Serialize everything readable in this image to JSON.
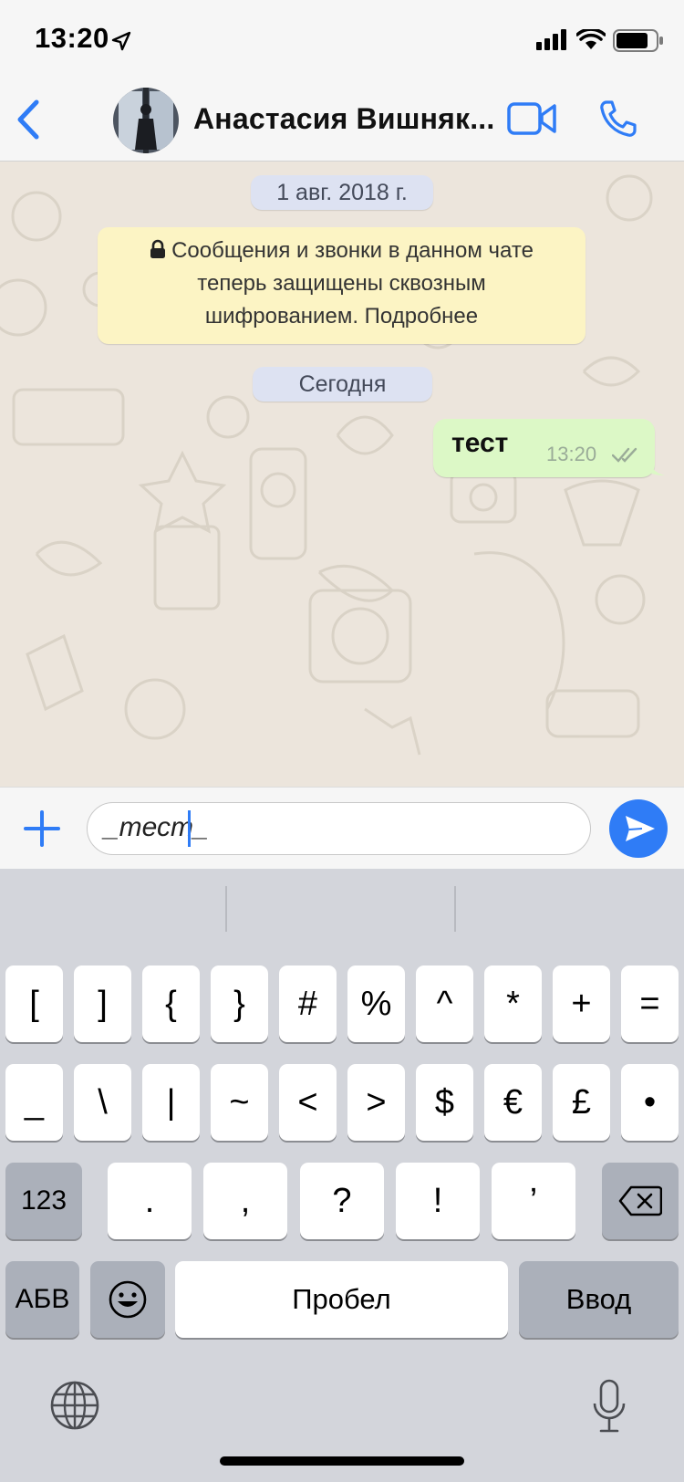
{
  "status_bar": {
    "time": "13:20"
  },
  "header": {
    "contact_name": "Анастасия Вишняк...",
    "accent_color": "#2f7cf6"
  },
  "chat": {
    "date_label": "1 авг. 2018 г.",
    "encryption_notice": {
      "lines": [
        "Сообщения и звонки в данном чате",
        "теперь защищены сквозным",
        "шифрованием. Подробнее"
      ]
    },
    "today_label": "Сегодня",
    "message": {
      "text": "тест",
      "time": "13:20",
      "status": "read"
    }
  },
  "composer": {
    "input_value": "_тест_"
  },
  "keyboard": {
    "row1": [
      "[",
      "]",
      "{",
      "}",
      "#",
      "%",
      "^",
      "*",
      "+",
      "="
    ],
    "row2": [
      "_",
      "\\",
      "|",
      "~",
      "<",
      ">",
      "$",
      "€",
      "£",
      "•"
    ],
    "row3": {
      "mode_key": "123",
      "keys": [
        ".",
        ",",
        "?",
        "!",
        "’"
      ]
    },
    "row4": {
      "abc_key": "АБВ",
      "space_key": "Пробел",
      "return_key": "Ввод"
    }
  }
}
